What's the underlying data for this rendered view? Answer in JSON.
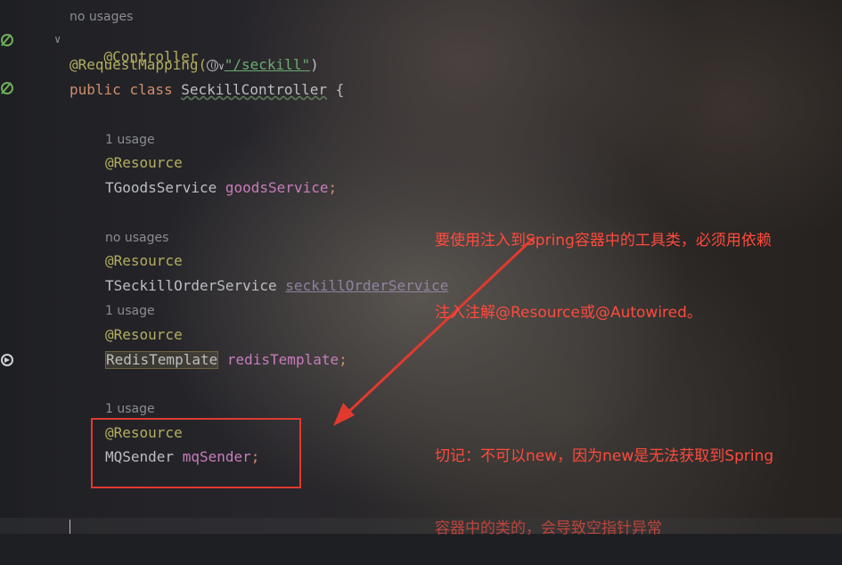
{
  "editor": {
    "hints": {
      "class_usages": "no usages",
      "goods_usages": "1 usage",
      "order_usages": "no usages",
      "redis_usages": "1 usage",
      "mq_usages": "1 usage"
    },
    "code": {
      "controller_annotation": "@Controller",
      "request_mapping_prefix": "@RequestMapping(",
      "request_mapping_chevron": "∨",
      "request_mapping_path": "\"/seckill\"",
      "request_mapping_suffix": ")",
      "class_kw_public": "public",
      "class_kw_class": "class",
      "class_name": "SeckillController",
      "class_brace": "{",
      "resource_annotation": "@Resource",
      "goods_type": "TGoodsService",
      "goods_field": "goodsService",
      "order_type": "TSeckillOrderService",
      "order_field": "seckillOrderService",
      "redis_type": "RedisTemplate",
      "redis_field": "redisTemplate",
      "mq_type": "MQSender",
      "mq_field": "mqSender",
      "semicolon": ";"
    }
  },
  "annotation_note": {
    "line1": "要使用注入到Spring容器中的工具类，必须用依赖",
    "line2": "注入注解@Resource或@Autowired。",
    "line3": "切记：不可以new，因为new是无法获取到Spring",
    "line4": "容器中的类的，会导致空指针异常",
    "color": "#ff4a3d"
  },
  "icons": [
    "bean-icon",
    "bean-icon",
    "run-gutter-icon",
    "globe-icon",
    "fold-chevron-icon"
  ]
}
